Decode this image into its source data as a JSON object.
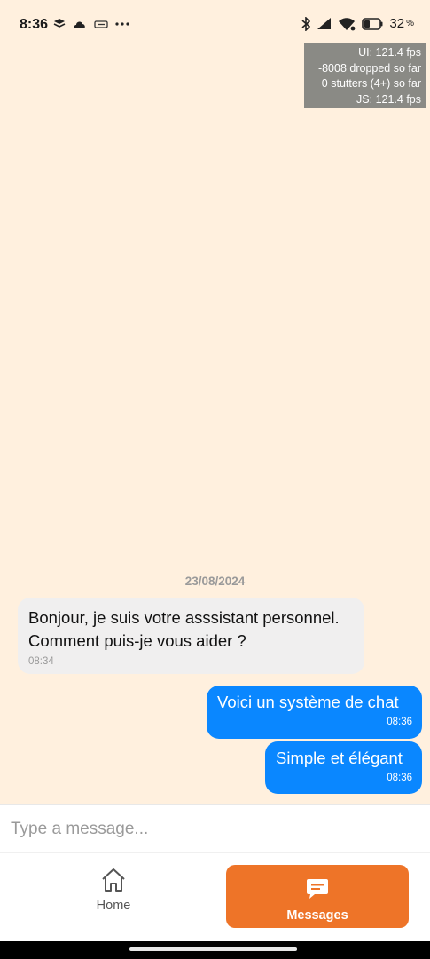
{
  "status_bar": {
    "time": "8:36",
    "battery": "32",
    "battery_unit": "%"
  },
  "perf_monitor": {
    "ui_fps": "UI: 121.4 fps",
    "dropped": "-8008 dropped so far",
    "stutters": "0 stutters (4+) so far",
    "js_fps": "JS: 121.4 fps"
  },
  "chat": {
    "date": "23/08/2024",
    "messages": [
      {
        "direction": "incoming",
        "text": "Bonjour, je suis votre asssistant personnel. Comment puis-je vous aider ?",
        "time": "08:34"
      },
      {
        "direction": "outgoing",
        "text": "Voici un système de chat",
        "time": "08:36"
      },
      {
        "direction": "outgoing",
        "text": "Simple et élégant",
        "time": "08:36"
      }
    ]
  },
  "input": {
    "placeholder": "Type a message...",
    "value": ""
  },
  "nav": {
    "home_label": "Home",
    "home_icon": "house-icon",
    "messages_label": "Messages",
    "messages_icon": "chat-bubble-icon",
    "active": "messages"
  },
  "colors": {
    "background": "#FFF0DE",
    "outgoing_bubble": "#0A87FF",
    "incoming_bubble": "#F0EFEF",
    "accent": "#EE7428"
  }
}
